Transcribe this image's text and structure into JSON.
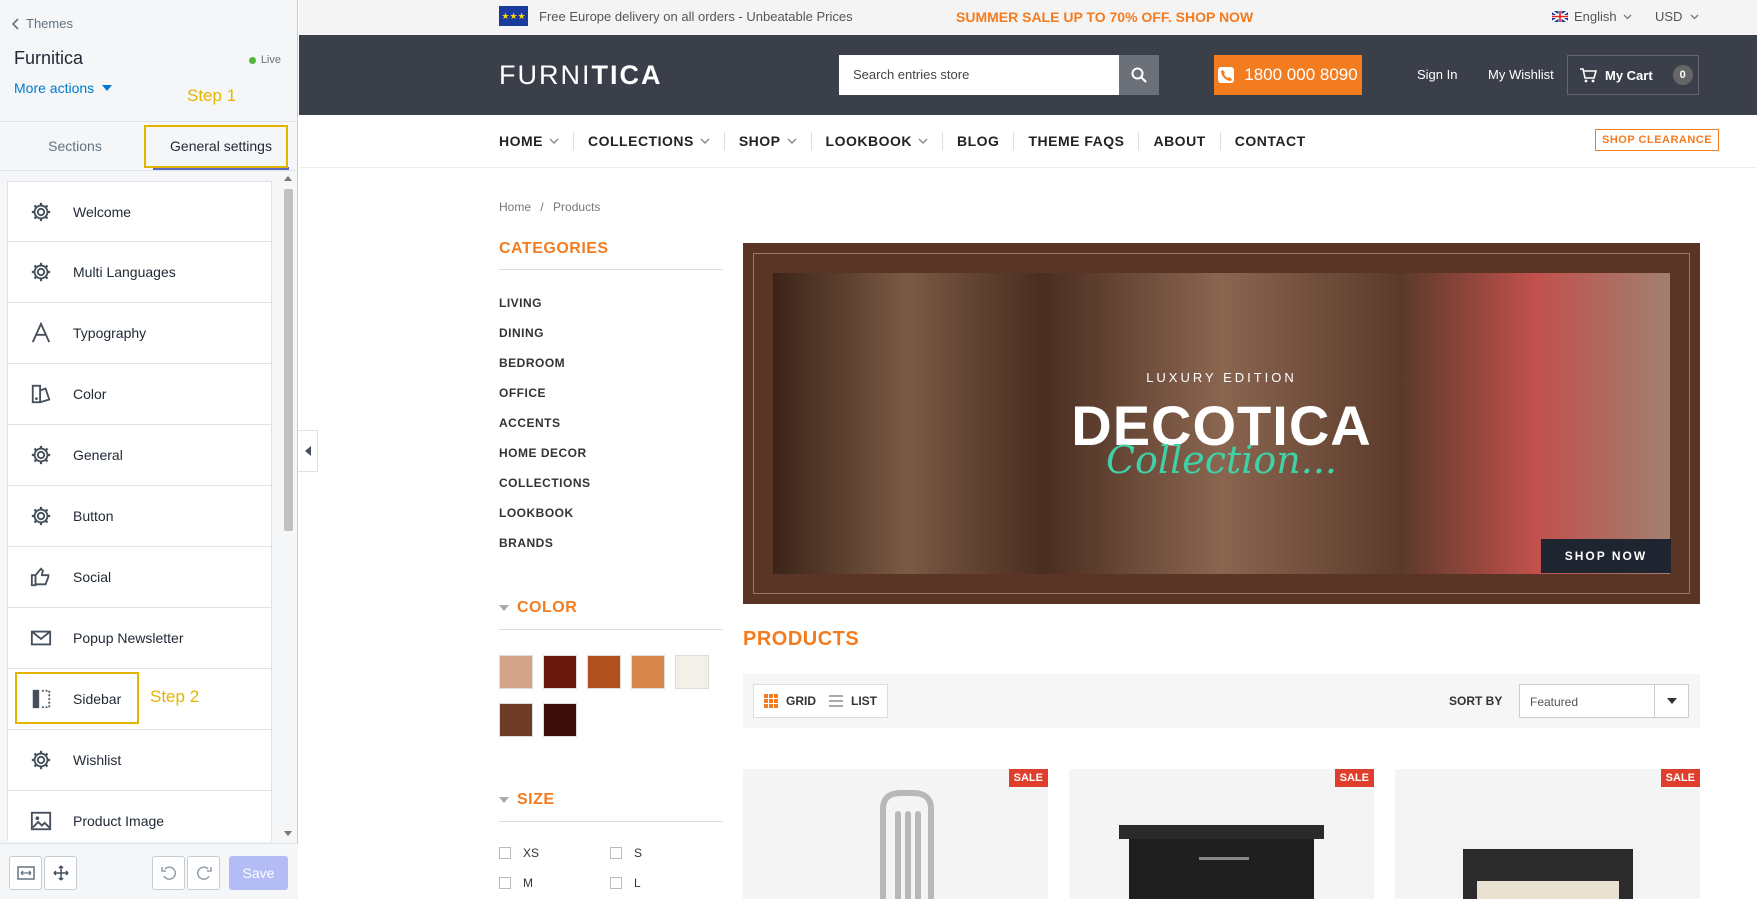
{
  "editor": {
    "back_label": "Themes",
    "theme_name": "Furnitica",
    "live_label": "Live",
    "more_actions": "More actions",
    "step1": "Step 1",
    "step2": "Step 2",
    "tabs": [
      "Sections",
      "General settings"
    ],
    "active_tab": "General settings",
    "items": [
      {
        "label": "Welcome",
        "icon": "gear-icon"
      },
      {
        "label": "Multi Languages",
        "icon": "gear-icon"
      },
      {
        "label": "Typography",
        "icon": "typography-icon"
      },
      {
        "label": "Color",
        "icon": "color-icon"
      },
      {
        "label": "General",
        "icon": "gear-icon"
      },
      {
        "label": "Button",
        "icon": "gear-icon"
      },
      {
        "label": "Social",
        "icon": "thumbs-up-icon"
      },
      {
        "label": "Popup Newsletter",
        "icon": "envelope-icon"
      },
      {
        "label": "Sidebar",
        "icon": "sidebar-icon"
      },
      {
        "label": "Wishlist",
        "icon": "gear-icon"
      },
      {
        "label": "Product Image",
        "icon": "image-icon"
      }
    ],
    "save_label": "Save"
  },
  "store": {
    "topbar": {
      "delivery": "Free Europe delivery on all orders - Unbeatable Prices",
      "sale": "SUMMER SALE UP TO 70% OFF. SHOP NOW",
      "language": "English",
      "currency": "USD"
    },
    "header": {
      "logo_light": "FURNI",
      "logo_bold": "TICA",
      "search_placeholder": "Search entries store",
      "phone": "1800 000 8090",
      "sign_in": "Sign In",
      "wishlist": "My Wishlist",
      "cart": "My Cart",
      "cart_count": "0"
    },
    "nav": [
      "HOME",
      "COLLECTIONS",
      "SHOP",
      "LOOKBOOK",
      "BLOG",
      "THEME FAQS",
      "ABOUT",
      "CONTACT"
    ],
    "nav_dropdowns": [
      true,
      true,
      true,
      true,
      false,
      false,
      false,
      false
    ],
    "shop_clearance": "SHOP CLEARANCE",
    "breadcrumb": {
      "home": "Home",
      "sep": "/",
      "current": "Products"
    },
    "categories_title": "CATEGORIES",
    "categories": [
      "LIVING",
      "DINING",
      "BEDROOM",
      "OFFICE",
      "ACCENTS",
      "HOME DECOR",
      "COLLECTIONS",
      "LOOKBOOK",
      "BRANDS"
    ],
    "color_title": "COLOR",
    "colors": [
      "#d4a48a",
      "#6a1a0c",
      "#b0501c",
      "#d8874c",
      "#f3f0ea",
      "#6e3c26",
      "#3a0d0a"
    ],
    "size_title": "SIZE",
    "sizes": [
      "XS",
      "S",
      "M",
      "L"
    ],
    "banner": {
      "subtitle": "LUXURY EDITION",
      "title": "DECOTICA",
      "script": "Collection...",
      "button": "SHOP NOW"
    },
    "products_title": "PRODUCTS",
    "view_grid": "GRID",
    "view_list": "LIST",
    "sort_label": "SORT BY",
    "sort_value": "Featured",
    "sale_badge": "SALE"
  }
}
